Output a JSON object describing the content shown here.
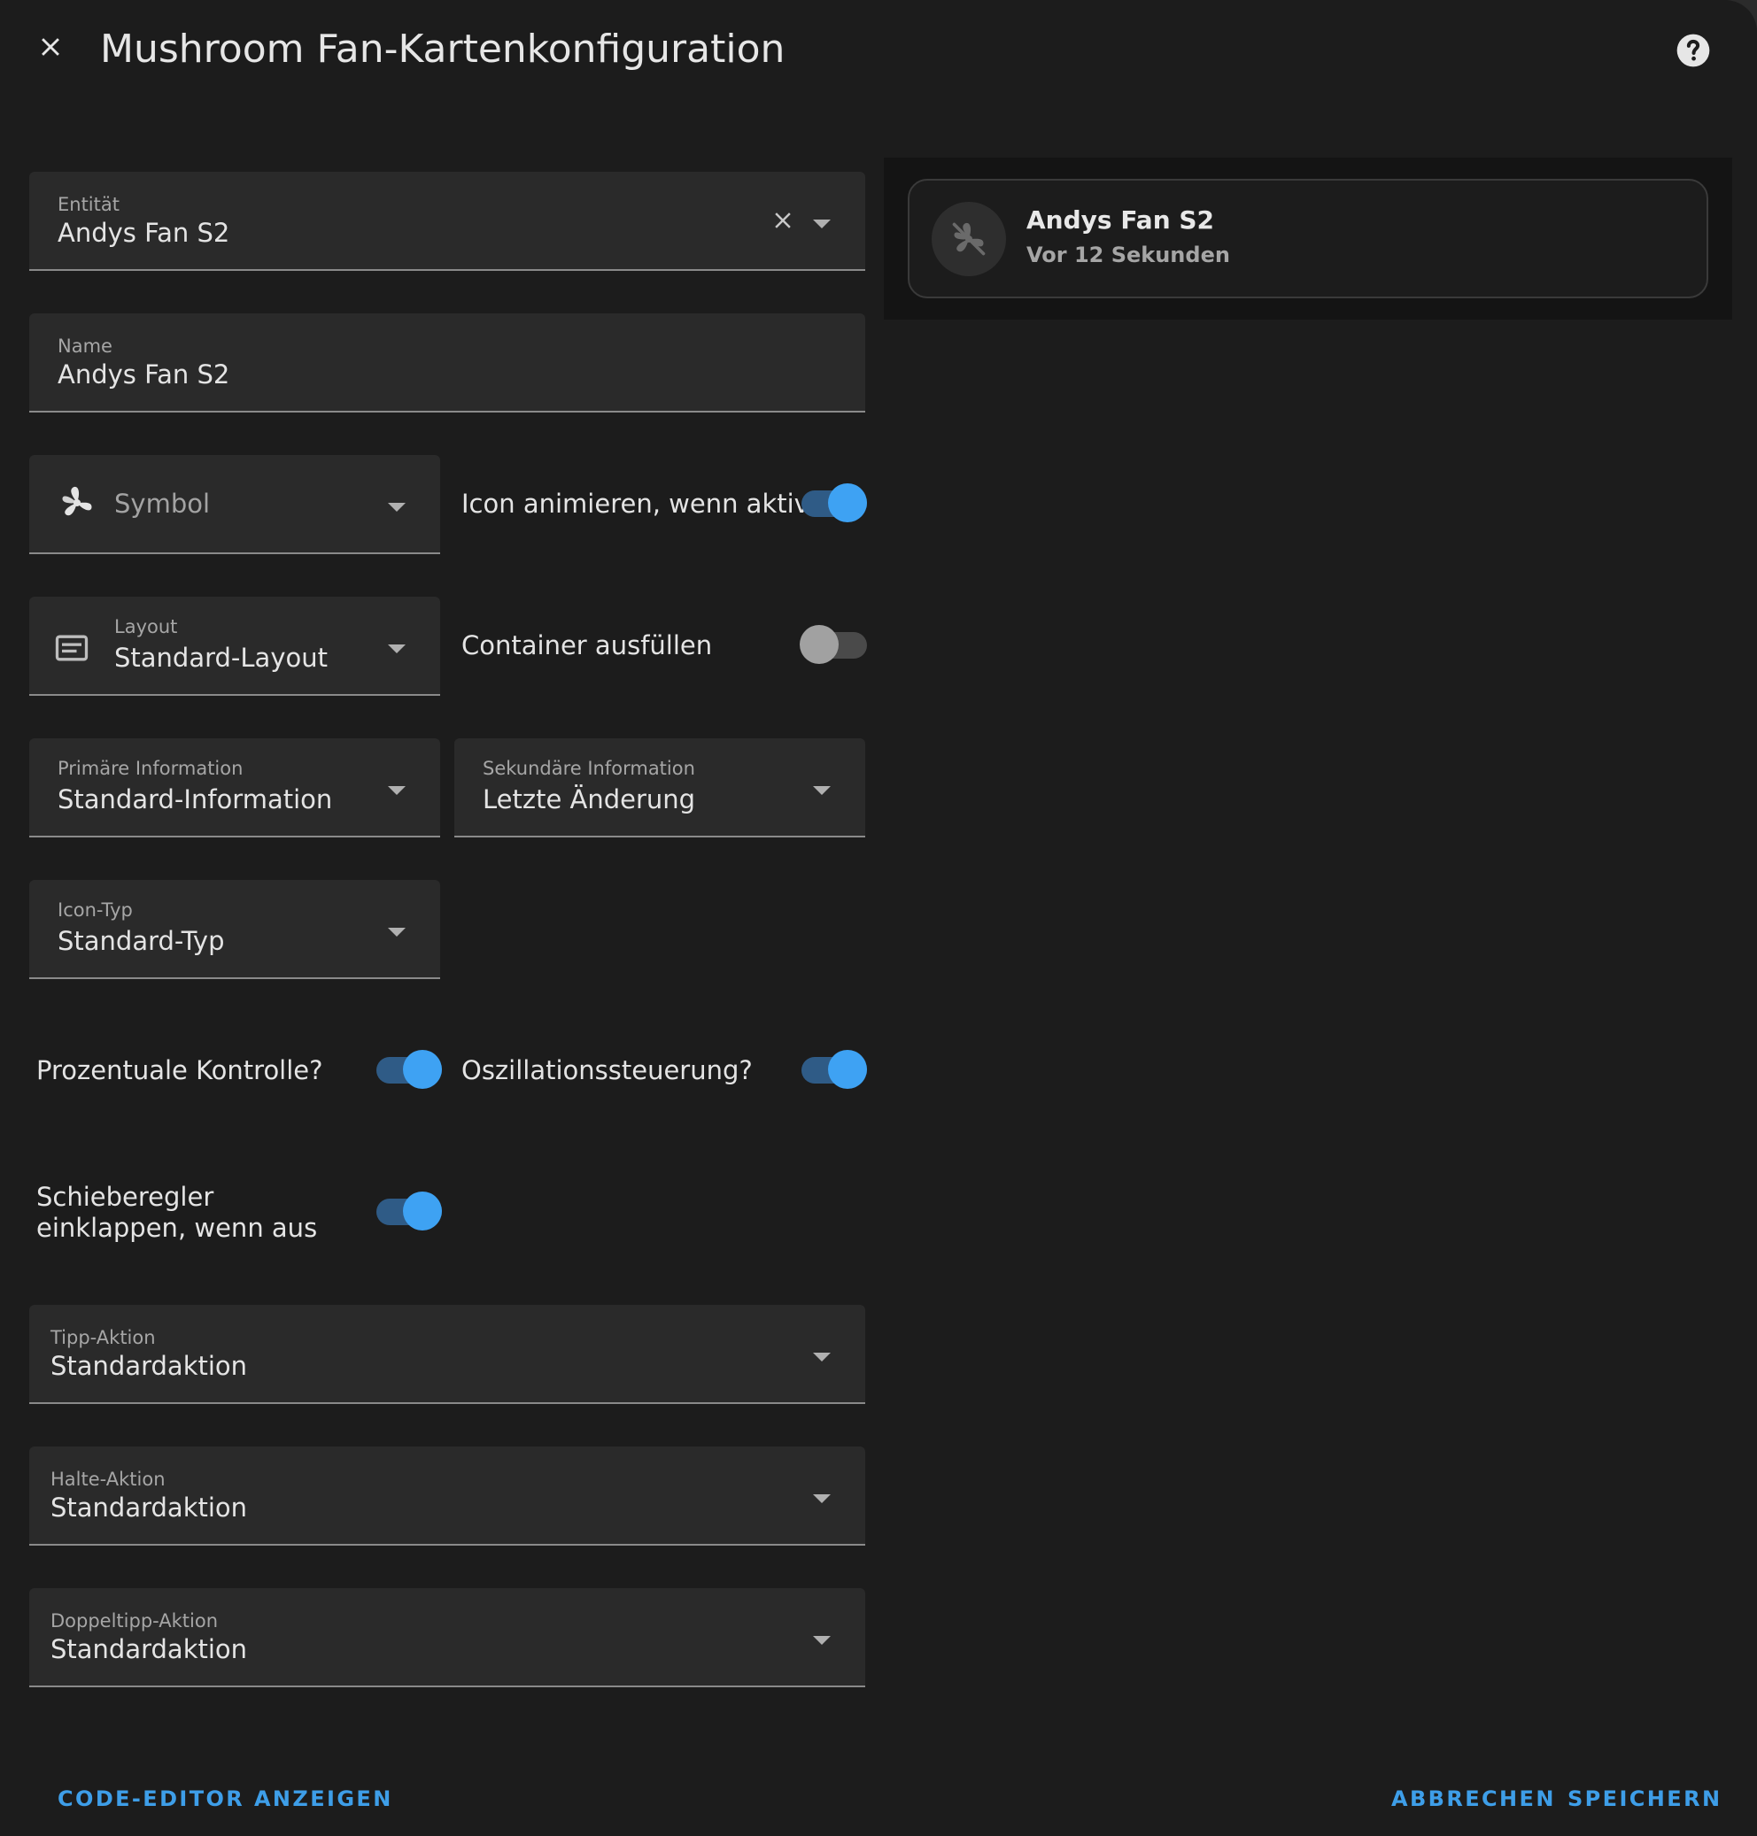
{
  "header": {
    "title": "Mushroom Fan-Kartenkonfiguration",
    "close_icon": "close-icon",
    "help_icon": "help-circle-icon"
  },
  "fields": {
    "entity": {
      "label": "Entität",
      "value": "Andys Fan S2"
    },
    "name": {
      "label": "Name",
      "value": "Andys Fan S2"
    },
    "icon": {
      "placeholder": "Symbol",
      "icon": "fan-icon"
    },
    "layout": {
      "label": "Layout",
      "value": "Standard-Layout",
      "icon": "card-text-icon"
    },
    "primary_info": {
      "label": "Primäre Information",
      "value": "Standard-Information"
    },
    "secondary_info": {
      "label": "Sekundäre Information",
      "value": "Letzte Änderung"
    },
    "icon_type": {
      "label": "Icon-Typ",
      "value": "Standard-Typ"
    },
    "tap_action": {
      "label": "Tipp-Aktion",
      "value": "Standardaktion"
    },
    "hold_action": {
      "label": "Halte-Aktion",
      "value": "Standardaktion"
    },
    "double_tap_action": {
      "label": "Doppeltipp-Aktion",
      "value": "Standardaktion"
    }
  },
  "toggles": {
    "icon_animation": {
      "label": "Icon animieren, wenn aktiv?",
      "on": true
    },
    "fill_container": {
      "label": "Container ausfüllen",
      "on": false
    },
    "percentage_control": {
      "label": "Prozentuale Kontrolle?",
      "on": true
    },
    "oscillation_control": {
      "label": "Oszillationssteuerung?",
      "on": true
    },
    "collapsible_controls": {
      "label": "Schieberegler einklappen, wenn aus",
      "on": true
    }
  },
  "preview": {
    "name": "Andys Fan S2",
    "secondary": "Vor 12 Sekunden",
    "icon": "fan-off-icon"
  },
  "footer": {
    "code_editor": "CODE-EDITOR ANZEIGEN",
    "cancel": "ABBRECHEN",
    "save": "SPEICHERN"
  },
  "colors": {
    "accent": "#3ea2f3",
    "background": "#1c1c1c",
    "field_background": "#2a2a2a"
  }
}
